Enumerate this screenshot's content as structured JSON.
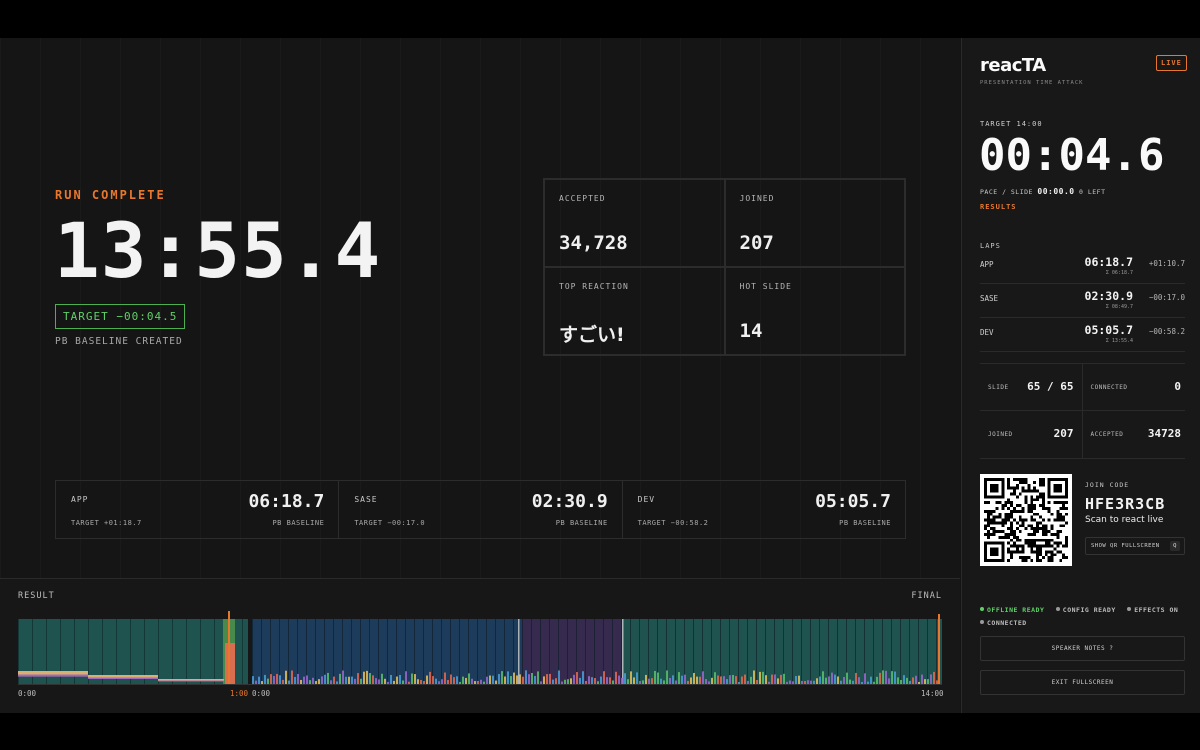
{
  "main": {
    "run_label": "RUN COMPLETE",
    "big_time": "13:55.4",
    "target_badge": "TARGET −00:04.5",
    "pb_note": "PB BASELINE CREATED",
    "stats": [
      {
        "label": "ACCEPTED",
        "value": "34,728"
      },
      {
        "label": "JOINED",
        "value": "207"
      },
      {
        "label": "TOP REACTION",
        "value": "すごい!"
      },
      {
        "label": "HOT SLIDE",
        "value": "14"
      }
    ],
    "laps": [
      {
        "name": "APP",
        "time": "06:18.7",
        "target": "TARGET +01:18.7",
        "pb": "PB BASELINE"
      },
      {
        "name": "SASE",
        "time": "02:30.9",
        "target": "TARGET −00:17.0",
        "pb": "PB BASELINE"
      },
      {
        "name": "DEV",
        "time": "05:05.7",
        "target": "TARGET −00:58.2",
        "pb": "PB BASELINE"
      }
    ]
  },
  "result": {
    "title": "RESULT",
    "final": "FINAL",
    "labels": {
      "start_a": "0:00",
      "end_a": "1:00",
      "start_b": "0:00",
      "end_b": "14:00"
    },
    "colors": {
      "teal": "#1f5a55",
      "blue": "#1e3f63",
      "purple": "#3a2e55",
      "accent": "#e8772e"
    }
  },
  "sidebar": {
    "brand": "reacTA",
    "brand_sub": "PRESENTATION TIME ATTACK",
    "live": "LIVE",
    "target": "TARGET 14:00",
    "timer": "00:04.6",
    "pace_label": "PACE / SLIDE",
    "pace_value": "00:00.0",
    "pace_left": "0 LEFT",
    "results_link": "RESULTS",
    "laps_title": "LAPS",
    "laps": [
      {
        "name": "APP",
        "time": "06:18.7",
        "sub": "Σ 06:18.7",
        "delta": "+01:10.7"
      },
      {
        "name": "SASE",
        "time": "02:30.9",
        "sub": "Σ 08:49.7",
        "delta": "−00:17.0"
      },
      {
        "name": "DEV",
        "time": "05:05.7",
        "sub": "Σ 13:55.4",
        "delta": "−00:58.2"
      }
    ],
    "mini": [
      {
        "label": "SLIDE",
        "value": "65 / 65"
      },
      {
        "label": "CONNECTED",
        "value": "0"
      },
      {
        "label": "JOINED",
        "value": "207"
      },
      {
        "label": "ACCEPTED",
        "value": "34728"
      }
    ],
    "join_label": "JOIN CODE",
    "join_code": "HFE3R3CB",
    "scan_text": "Scan to react live",
    "qr_button": "SHOW QR FULLSCREEN",
    "qr_key": "Q",
    "status": [
      "OFFLINE READY",
      "CONFIG READY",
      "EFFECTS ON",
      "CONNECTED"
    ],
    "speaker_notes": "SPEAKER NOTES ?",
    "exit_fullscreen": "EXIT FULLSCREEN"
  }
}
